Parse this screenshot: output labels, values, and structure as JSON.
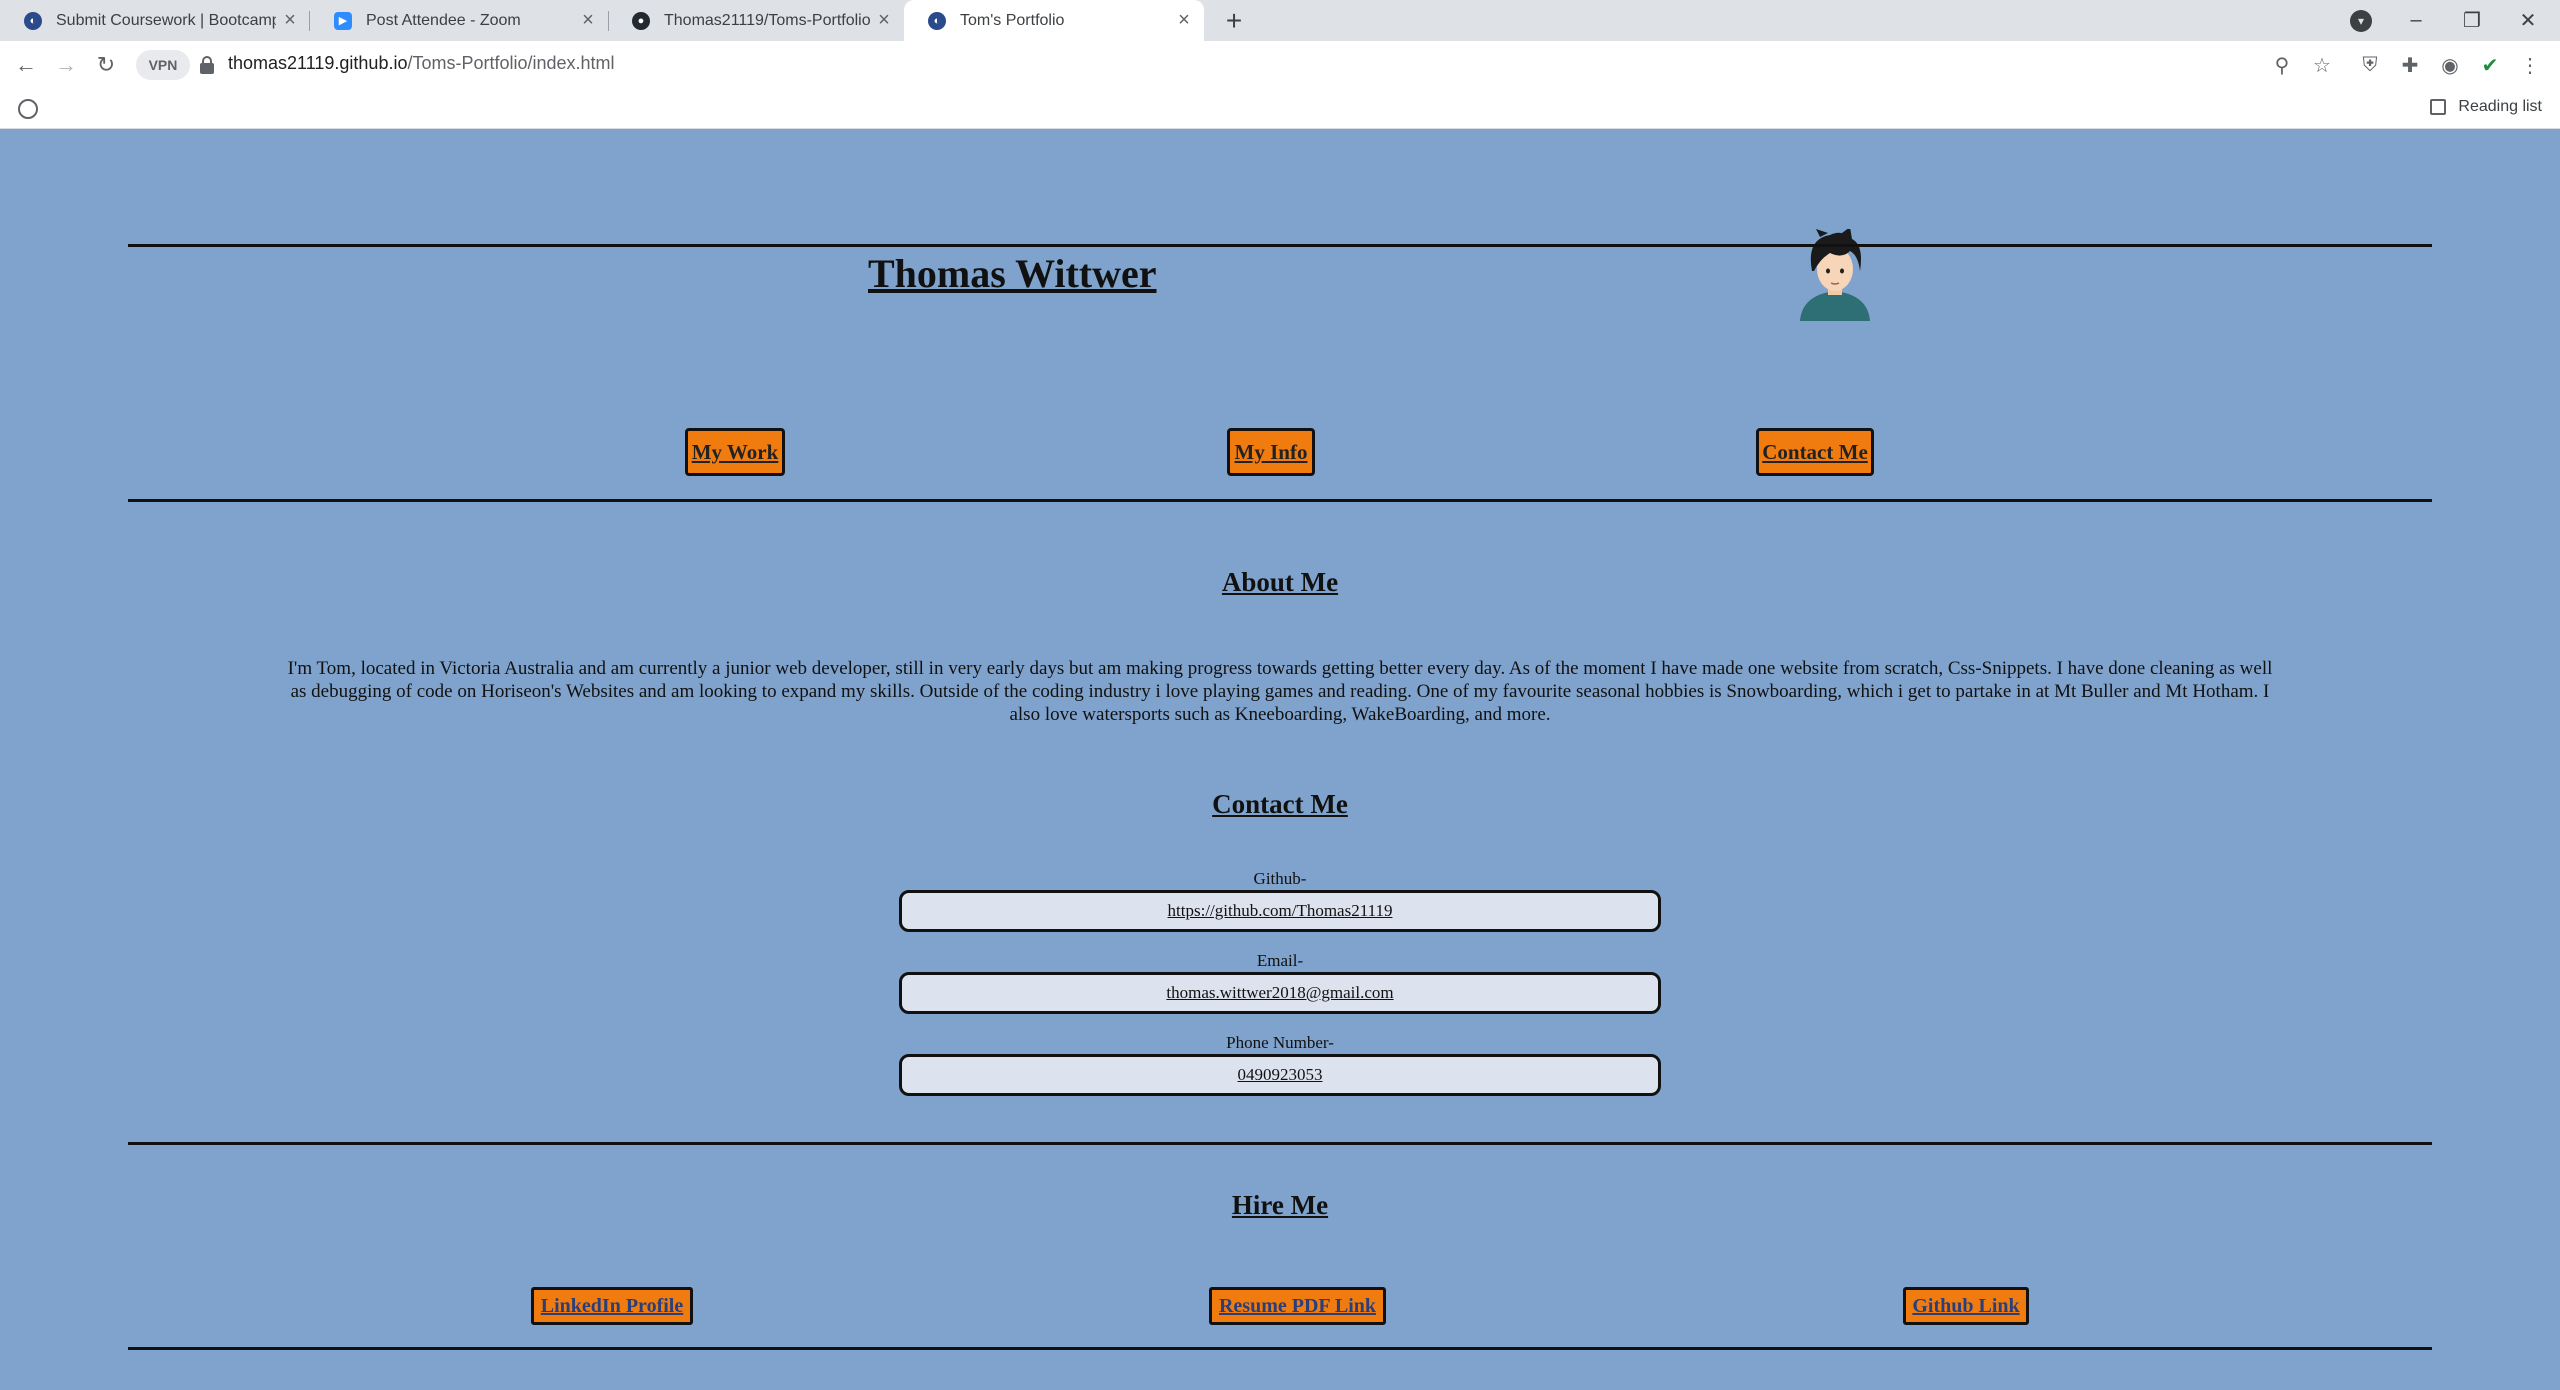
{
  "browser": {
    "tabs": [
      {
        "title": "Submit Coursework | Bootcamp S"
      },
      {
        "title": "Post Attendee - Zoom"
      },
      {
        "title": "Thomas21119/Toms-Portfolio"
      },
      {
        "title": "Tom's Portfolio"
      }
    ],
    "vpn_label": "VPN",
    "url_host": "thomas21119.github.io",
    "url_path": "/Toms-Portfolio/index.html",
    "reading_list": "Reading list"
  },
  "site": {
    "name": "Thomas Wittwer",
    "nav": [
      "My Work",
      "My Info",
      "Contact Me"
    ],
    "about_heading": "About Me",
    "about_text": "I'm Tom, located in Victoria Australia and am currently a junior web developer, still in very early days but am making progress towards getting better every day. As of the moment I have made one website from scratch, Css-Snippets. I have done cleaning as well as debugging of code on Horiseon's Websites and am looking to expand my skills. Outside of the coding industry i love playing games and reading. One of my favourite seasonal hobbies is Snowboarding, which i get to partake in at Mt Buller and Mt Hotham. I also love watersports such as Kneeboarding, WakeBoarding, and more.",
    "contact_heading": "Contact Me",
    "contacts": [
      {
        "label": "Github-",
        "value": "https://github.com/Thomas21119"
      },
      {
        "label": "Email-",
        "value": "thomas.wittwer2018@gmail.com"
      },
      {
        "label": "Phone Number-",
        "value": "0490923053"
      }
    ],
    "hire_heading": "Hire Me",
    "hire_links": [
      "LinkedIn Profile",
      "Resume PDF Link",
      "Github Link"
    ]
  },
  "colors": {
    "page_background": "#7fa3cc",
    "button_orange": "#f07c10",
    "contact_box": "#dde3ee"
  }
}
